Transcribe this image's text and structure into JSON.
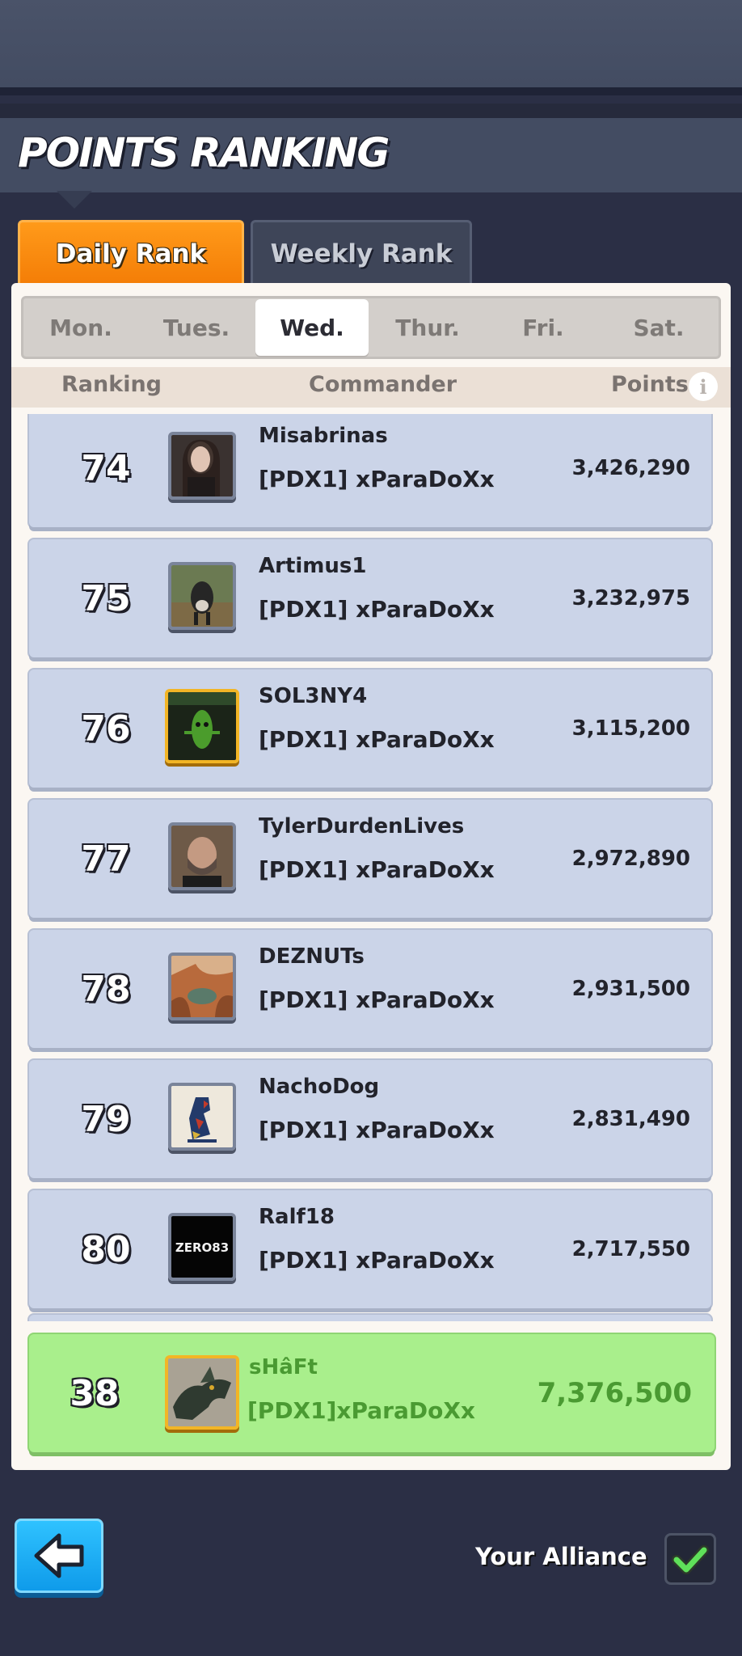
{
  "header": {
    "title": "POINTS RANKING"
  },
  "tabs": [
    {
      "label": "Daily Rank",
      "active": true
    },
    {
      "label": "Weekly Rank",
      "active": false
    }
  ],
  "days": [
    {
      "label": "Mon.",
      "active": false
    },
    {
      "label": "Tues.",
      "active": false
    },
    {
      "label": "Wed.",
      "active": true
    },
    {
      "label": "Thur.",
      "active": false
    },
    {
      "label": "Fri.",
      "active": false
    },
    {
      "label": "Sat.",
      "active": false
    }
  ],
  "columns": {
    "ranking": "Ranking",
    "commander": "Commander",
    "points": "Points",
    "info_icon": "i"
  },
  "rows": [
    {
      "rank": "74",
      "name": "Misabrinas",
      "alliance": "[PDX1] xParaDoXx",
      "points": "3,426,290",
      "avatar": "portrait-woman",
      "frame": "silver"
    },
    {
      "rank": "75",
      "name": "Artimus1",
      "alliance": "[PDX1] xParaDoXx",
      "points": "3,232,975",
      "avatar": "cow-photo",
      "frame": "silver"
    },
    {
      "rank": "76",
      "name": "SOL3NY4",
      "alliance": "[PDX1] xParaDoXx",
      "points": "3,115,200",
      "avatar": "pickle-character",
      "frame": "gold"
    },
    {
      "rank": "77",
      "name": "TylerDurdenLives",
      "alliance": "[PDX1] xParaDoXx",
      "points": "2,972,890",
      "avatar": "portrait-man",
      "frame": "silver"
    },
    {
      "rank": "78",
      "name": "DEZNUTs",
      "alliance": "[PDX1] xParaDoXx",
      "points": "2,931,500",
      "avatar": "canyon-photo",
      "frame": "silver"
    },
    {
      "rank": "79",
      "name": "NachoDog",
      "alliance": "[PDX1] xParaDoXx",
      "points": "2,831,490",
      "avatar": "dog-art",
      "frame": "silver"
    },
    {
      "rank": "80",
      "name": "Ralf18",
      "alliance": "[PDX1] xParaDoXx",
      "points": "2,717,550",
      "avatar": "zero83-logo",
      "frame": "silver",
      "avatar_text": "ZERO83"
    }
  ],
  "my_row": {
    "rank": "38",
    "name": "sHâFt",
    "alliance": "[PDX1]xParaDoXx",
    "points": "7,376,500",
    "avatar": "dragon-art",
    "frame": "gold"
  },
  "footer": {
    "back_icon": "arrow-left-icon",
    "your_alliance_label": "Your Alliance",
    "your_alliance_checked": true
  },
  "colors": {
    "accent_orange": "#f47d06",
    "row_bg": "#cbd4e8",
    "my_row_bg": "#a9ef8c",
    "my_row_text": "#4a9a32",
    "back_button": "#1aa8f2"
  }
}
